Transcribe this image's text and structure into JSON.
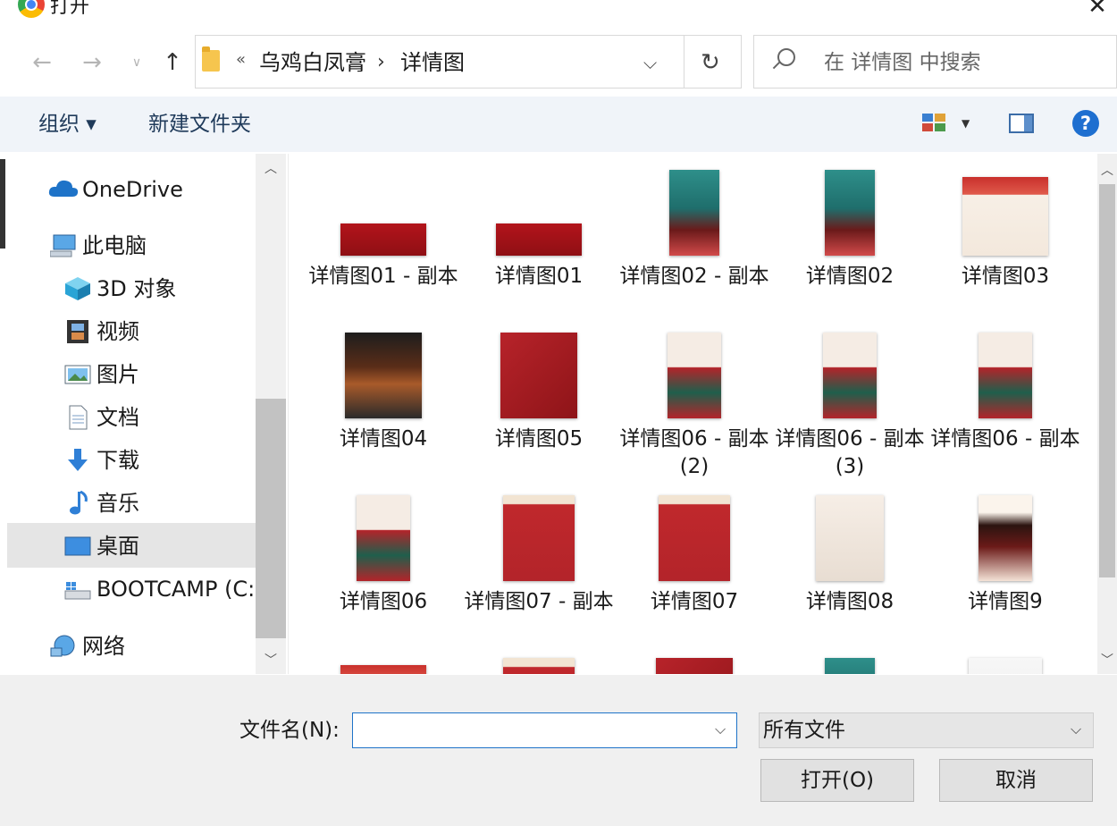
{
  "window": {
    "title": "打开"
  },
  "address": {
    "breadcrumb_chevron": "«",
    "crumbs": [
      "乌鸡白凤膏",
      "详情图"
    ],
    "separator": "›"
  },
  "search": {
    "placeholder": "在 详情图 中搜索"
  },
  "toolbar": {
    "organize": "组织 ▾",
    "new_folder": "新建文件夹",
    "help": "?"
  },
  "nav": {
    "items": [
      {
        "label": "OneDrive",
        "icon": "cloud-icon"
      },
      {
        "label": "此电脑",
        "icon": "computer-icon"
      },
      {
        "label": "3D 对象",
        "icon": "cube-icon"
      },
      {
        "label": "视频",
        "icon": "film-icon"
      },
      {
        "label": "图片",
        "icon": "picture-icon"
      },
      {
        "label": "文档",
        "icon": "document-icon"
      },
      {
        "label": "下载",
        "icon": "download-icon"
      },
      {
        "label": "音乐",
        "icon": "music-icon"
      },
      {
        "label": "桌面",
        "icon": "desktop-icon",
        "selected": true
      },
      {
        "label": "BOOTCAMP (C:",
        "icon": "drive-icon"
      },
      {
        "label": "网络",
        "icon": "network-icon"
      }
    ]
  },
  "files": [
    {
      "label": "详情图01 - 副本",
      "thumb": "banner"
    },
    {
      "label": "详情图01",
      "thumb": "banner"
    },
    {
      "label": "详情图02 - 副本",
      "thumb": "jar"
    },
    {
      "label": "详情图02",
      "thumb": "jar"
    },
    {
      "label": "详情图03",
      "thumb": "cream"
    },
    {
      "label": "详情图04",
      "thumb": "gold"
    },
    {
      "label": "详情图05",
      "thumb": "red-spoon"
    },
    {
      "label": "详情图06 - 副本 (2)",
      "thumb": "red-grid"
    },
    {
      "label": "详情图06 - 副本 (3)",
      "thumb": "red-grid"
    },
    {
      "label": "详情图06 - 副本",
      "thumb": "red-grid"
    },
    {
      "label": "详情图06",
      "thumb": "red-grid"
    },
    {
      "label": "详情图07 - 副本",
      "thumb": "red-text"
    },
    {
      "label": "详情图07",
      "thumb": "red-text"
    },
    {
      "label": "详情图08",
      "thumb": "beige-photos"
    },
    {
      "label": "详情图9",
      "thumb": "spoon-white"
    },
    {
      "label": "",
      "thumb": "cream"
    },
    {
      "label": "",
      "thumb": "red-text"
    },
    {
      "label": "",
      "thumb": "red-spoon"
    },
    {
      "label": "",
      "thumb": "jar"
    },
    {
      "label": "",
      "thumb": "white"
    }
  ],
  "bottom": {
    "filename_label": "文件名(N):",
    "filename_value": "",
    "filetype_value": "所有文件",
    "open_label": "打开(O)",
    "cancel_label": "取消"
  },
  "colors": {
    "accent": "#1e73c8",
    "toolbar_bg": "#f0f4f9",
    "panel_bg": "#f0f0f0"
  }
}
